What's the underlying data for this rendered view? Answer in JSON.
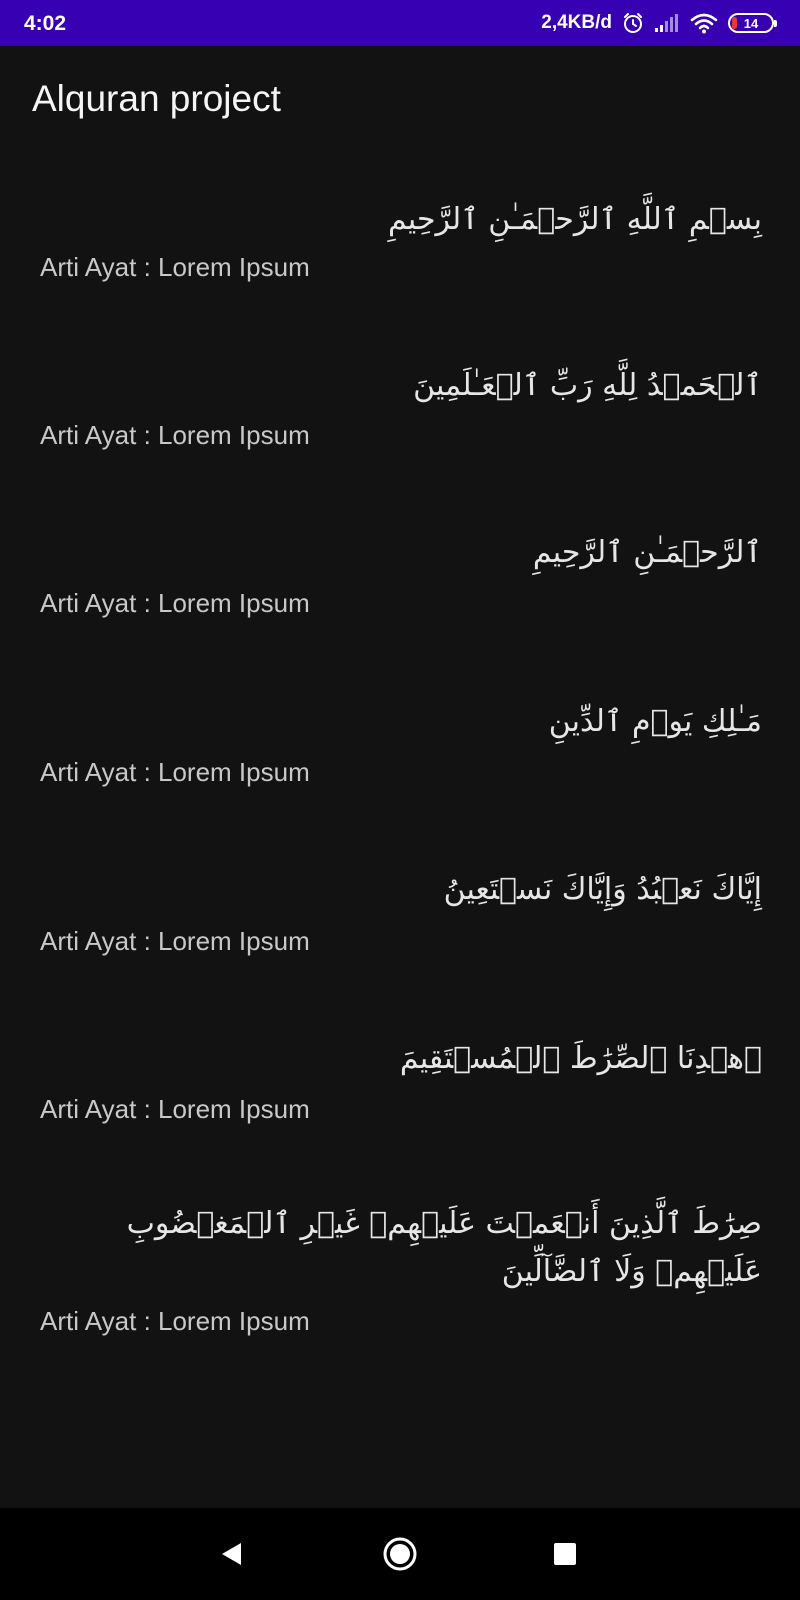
{
  "status_bar": {
    "time": "4:02",
    "network_speed": "2,4KB/d",
    "battery_level": "14",
    "battery_fraction": 0.14,
    "battery_color": "#e53935",
    "bar_color": "#3700b3",
    "icons": [
      "alarm-icon",
      "signal-icon",
      "wifi-icon",
      "battery-icon"
    ]
  },
  "app_bar": {
    "title": "Alquran project"
  },
  "ayat": [
    {
      "arabic": "بِسۡمِ ٱللَّهِ ٱلرَّحۡمَـٰنِ ٱلرَّحِيمِ",
      "translation": "Arti Ayat : Lorem Ipsum"
    },
    {
      "arabic": "ٱلۡحَمۡدُ لِلَّهِ رَبِّ ٱلۡعَـٰلَمِينَ",
      "translation": "Arti Ayat : Lorem Ipsum"
    },
    {
      "arabic": "ٱلرَّحۡمَـٰنِ ٱلرَّحِيمِ",
      "translation": "Arti Ayat : Lorem Ipsum"
    },
    {
      "arabic": "مَـٰلِكِ يَوۡمِ ٱلدِّينِ",
      "translation": "Arti Ayat : Lorem Ipsum"
    },
    {
      "arabic": "إِيَّاكَ نَعۡبُدُ وَإِيَّاكَ نَسۡتَعِينُ",
      "translation": "Arti Ayat : Lorem Ipsum"
    },
    {
      "arabic": "ٱهۡدِنَا ٱلصِّرَٰطَ ٱلۡمُسۡتَقِيمَ",
      "translation": "Arti Ayat : Lorem Ipsum"
    },
    {
      "arabic": "صِرَٰطَ ٱلَّذِينَ أَنۡعَمۡتَ عَلَيۡهِمۡ غَيۡرِ ٱلۡمَغۡضُوبِ عَلَيۡهِمۡ وَلَا ٱلضَّآلِّينَ",
      "translation": "Arti Ayat : Lorem Ipsum"
    }
  ],
  "nav_bar": {
    "buttons": [
      "back-icon",
      "home-icon",
      "recents-icon"
    ]
  }
}
